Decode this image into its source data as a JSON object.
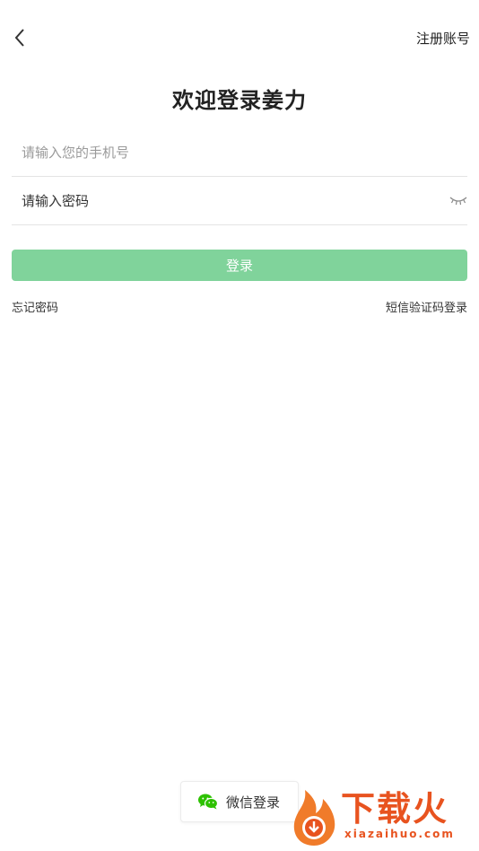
{
  "header": {
    "back_icon": "chevron-left-icon",
    "register_label": "注册账号"
  },
  "title": "欢迎登录姜力",
  "form": {
    "phone_placeholder": "请输入您的手机号",
    "phone_value": "",
    "password_placeholder": "请输入密码",
    "password_value": "",
    "password_toggle_icon": "eye-closed-icon"
  },
  "login_button": {
    "label": "登录",
    "color": "#80d39b"
  },
  "links": {
    "forgot_password": "忘记密码",
    "sms_login": "短信验证码登录"
  },
  "wechat_login": {
    "icon": "wechat-icon",
    "label": "微信登录",
    "icon_color": "#2dc100"
  },
  "watermark": {
    "brand": "下载火",
    "domain": "xiazaihuo.com",
    "color": "#e8531f"
  }
}
